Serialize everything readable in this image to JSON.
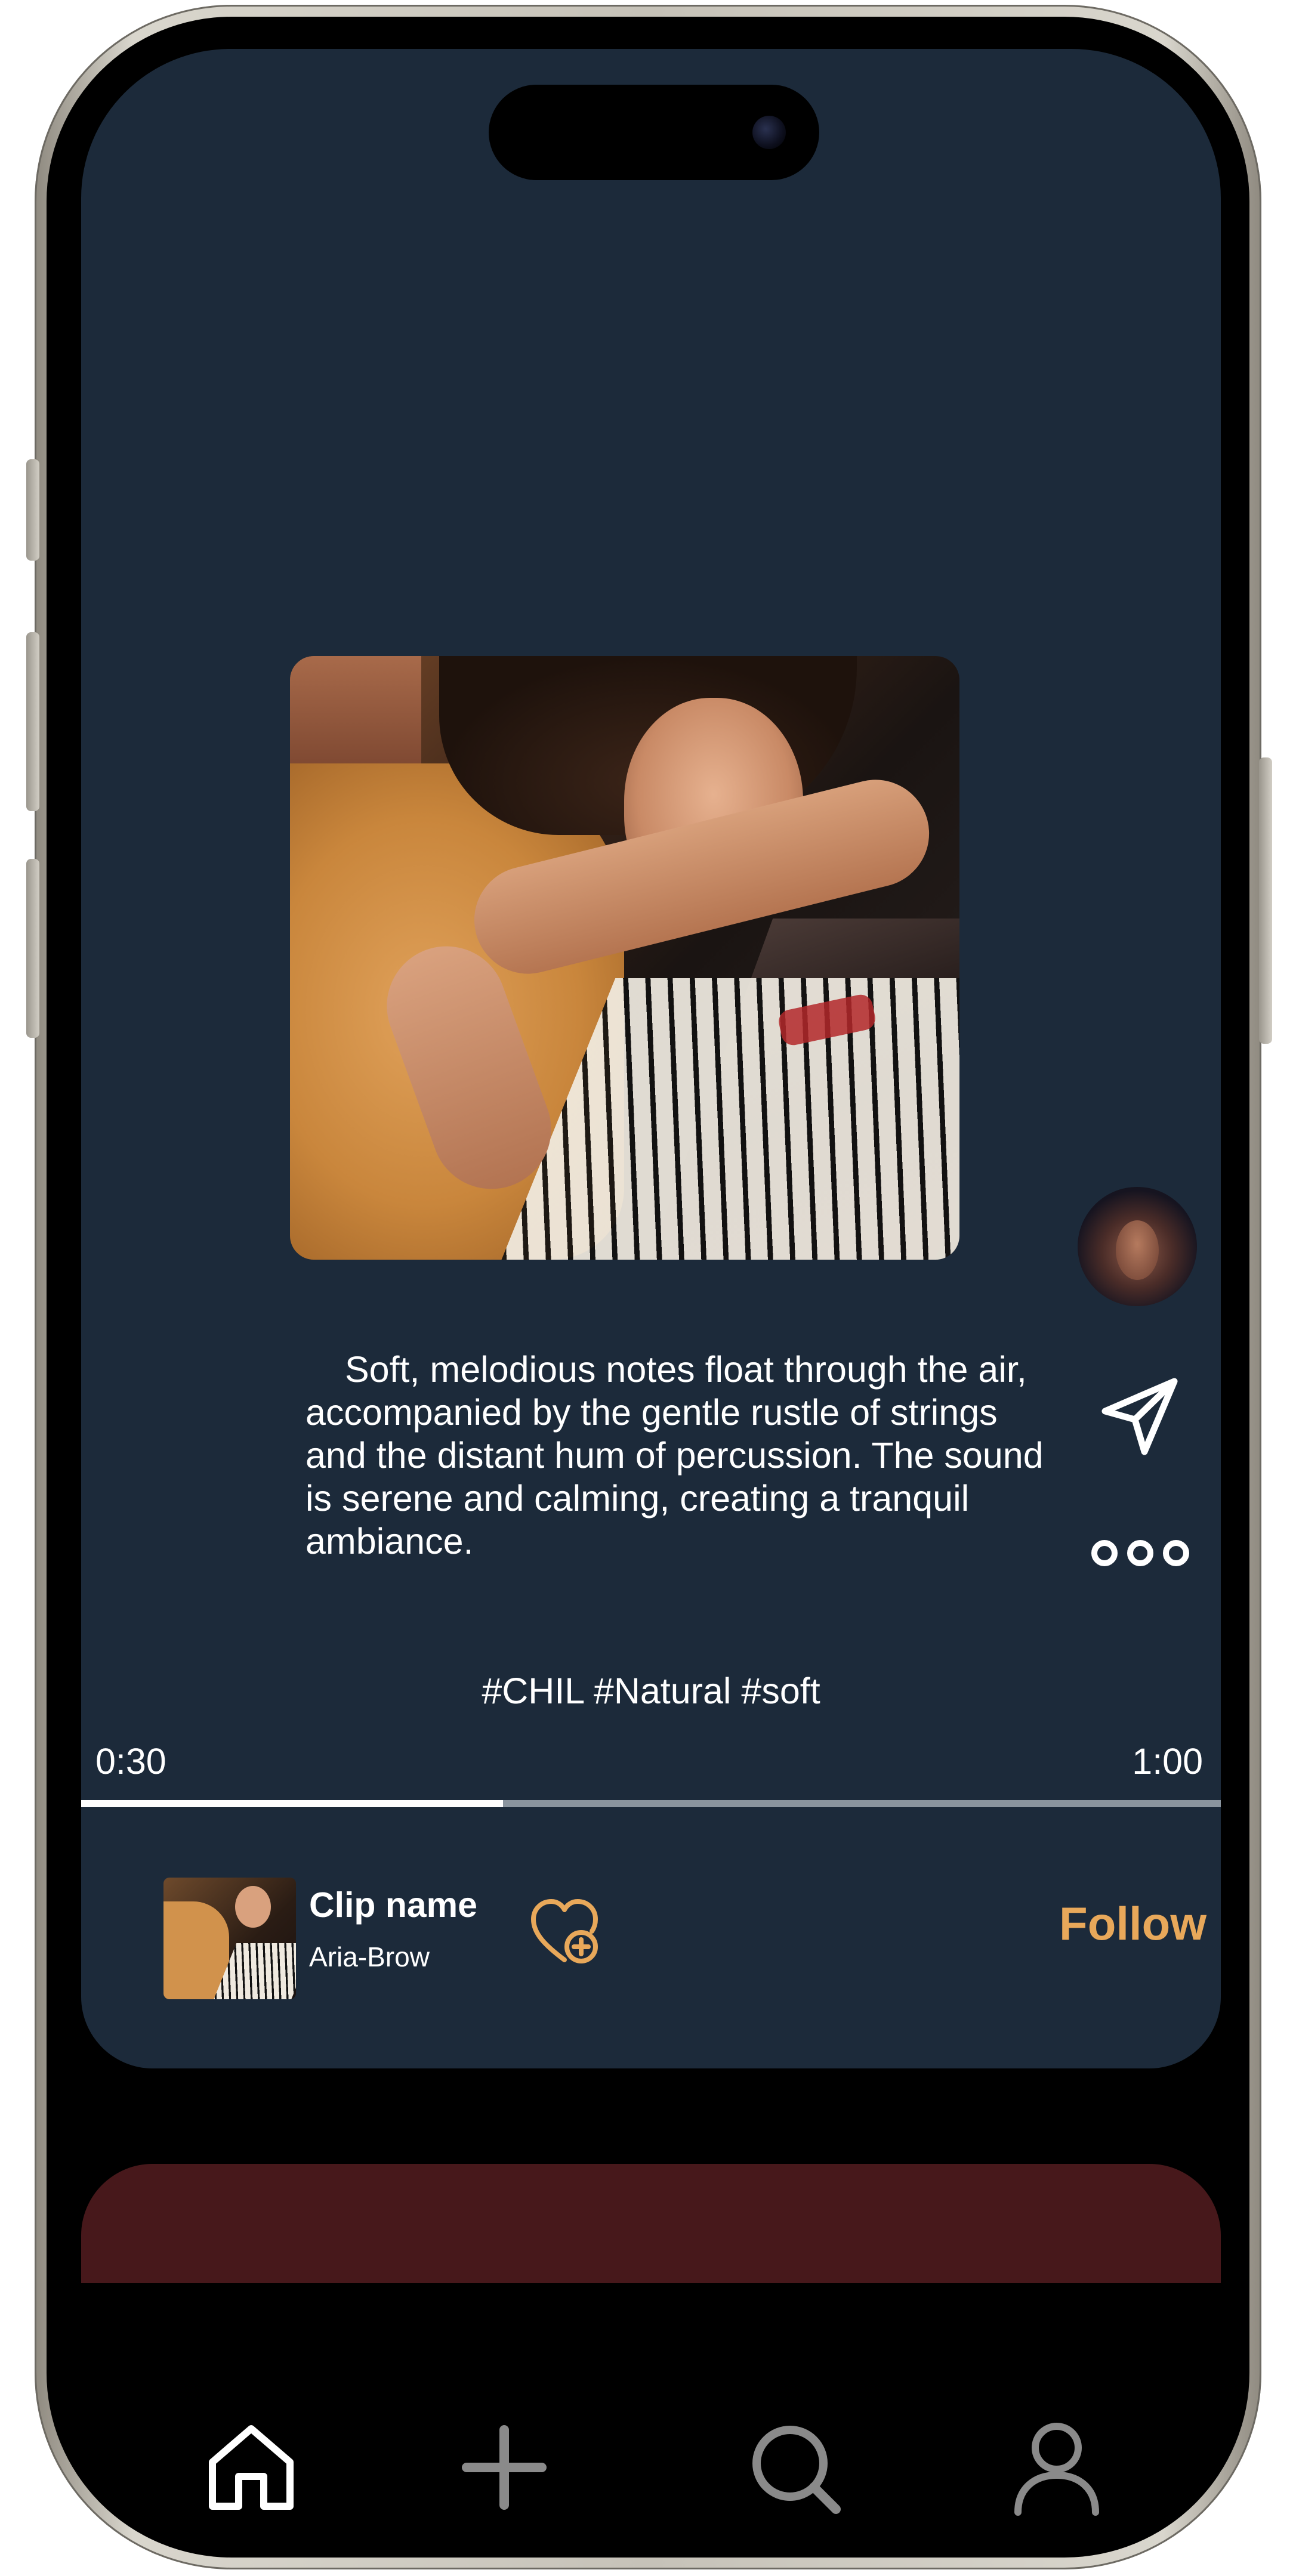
{
  "post": {
    "description": "Soft, melodious notes float through the air, accompanied by the gentle rustle of strings and the distant hum of percussion. The sound is serene and calming, creating a tranquil ambiance.",
    "hashtags": "#CHIL #Natural #soft",
    "cover_image": "woman-leaning-on-piano",
    "creator_avatar": "creator-portrait"
  },
  "player": {
    "current_time": "0:30",
    "total_time": "1:00",
    "progress_fraction": 0.37
  },
  "clip": {
    "title": "Clip name",
    "artist": "Aria-Brow",
    "follow_label": "Follow"
  },
  "side_actions": {
    "share_icon": "paper-plane-icon",
    "more_icon": "more-dots-icon"
  },
  "nav": {
    "items": [
      {
        "icon": "home-icon",
        "active": true
      },
      {
        "icon": "plus-icon",
        "active": false
      },
      {
        "icon": "search-icon",
        "active": false
      },
      {
        "icon": "profile-icon",
        "active": false
      }
    ]
  },
  "colors": {
    "card_bg": "#1c2a3a",
    "accent": "#e8a85a",
    "next_card": "#47181b",
    "nav_active": "#ffffff",
    "nav_inactive": "#8a8a8a"
  }
}
